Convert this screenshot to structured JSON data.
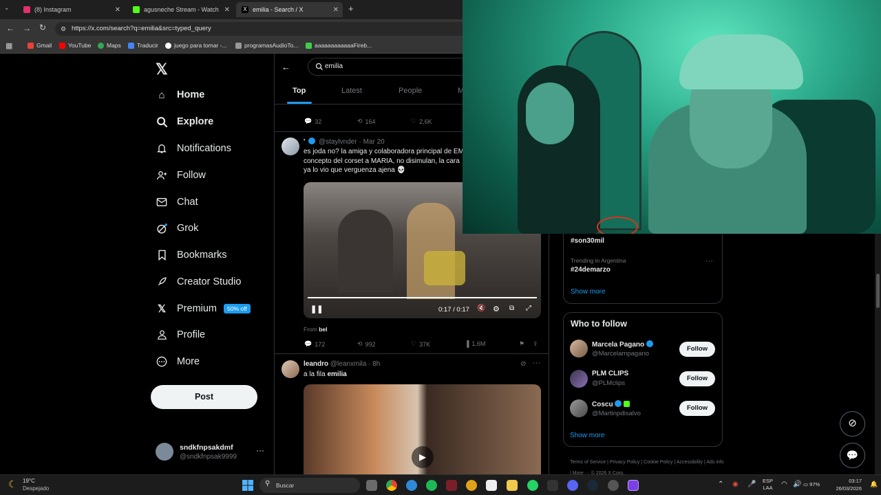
{
  "browser": {
    "tabs": [
      {
        "label": "(8) Instagram",
        "color": "#e1306c"
      },
      {
        "label": "agusneche Stream - Watch Live",
        "color": "#53fc18"
      },
      {
        "label": "emilia - Search / X",
        "color": "#ffffff"
      }
    ],
    "url": "https://x.com/search?q=emilia&src=typed_query",
    "bookmarks": [
      "Gmail",
      "YouTube",
      "Maps",
      "Traducir",
      "juego para tomar -...",
      "programasAudioTo...",
      "aaaaaaaaaaaaFireb..."
    ]
  },
  "sidebar": {
    "nav": [
      {
        "label": "Home",
        "icon": "home-icon"
      },
      {
        "label": "Explore",
        "icon": "search-icon"
      },
      {
        "label": "Notifications",
        "icon": "bell-icon"
      },
      {
        "label": "Follow",
        "icon": "person-plus-icon"
      },
      {
        "label": "Chat",
        "icon": "mail-icon"
      },
      {
        "label": "Grok",
        "icon": "grok-icon"
      },
      {
        "label": "Bookmarks",
        "icon": "bookmark-icon"
      },
      {
        "label": "Creator Studio",
        "icon": "rocket-icon"
      },
      {
        "label": "Premium",
        "icon": "x-logo-icon"
      },
      {
        "label": "Profile",
        "icon": "user-icon"
      },
      {
        "label": "More",
        "icon": "more-circle-icon"
      }
    ],
    "premium_badge": "50% off",
    "post_label": "Post",
    "account": {
      "name": "sndkfnpsakdmf",
      "handle": "@sndkfnpsak9999"
    }
  },
  "search": {
    "query": "emilia",
    "tabs": [
      "Top",
      "Latest",
      "People",
      "M"
    ]
  },
  "prev_tweet_actions": {
    "replies": "32",
    "reposts": "164",
    "likes": "2,6K"
  },
  "tweet1": {
    "name": "'",
    "handle": "@staylvnder",
    "time": "· Mar 20",
    "text_line1": "es joda no? la amiga y colaboradora principal de EM",
    "text_line2": "concepto del corset a MARIA, no disimulan, la cara",
    "text_line3": "ya lo vio que verguenza ajena 💀",
    "video_time": "0:17 / 0:17",
    "from_label": "From",
    "from_user": "bel",
    "replies": "172",
    "reposts": "992",
    "likes": "37K",
    "views": "1,6M"
  },
  "tweet2": {
    "name": "leandro",
    "handle": "@leanxmila",
    "time": "· 8h",
    "text_prefix": "a la fila",
    "text_bold": "emilia"
  },
  "trends": {
    "item1": "#son30mil",
    "item2_context": "Trending in Argentina",
    "item2": "#24demarzo",
    "show_more": "Show more"
  },
  "who_to_follow": {
    "title": "Who to follow",
    "users": [
      {
        "name": "Marcela Pagano",
        "handle": "@Marcelampagano",
        "button": "Follow"
      },
      {
        "name": "PLM CLIPS",
        "handle": "@PLMclips",
        "button": "Follow"
      },
      {
        "name": "Coscu",
        "handle": "@Martinpdisalvo",
        "button": "Follow"
      }
    ],
    "show_more": "Show more"
  },
  "footer": {
    "links": [
      "Terms of Service",
      "Privacy Policy",
      "Cookie Policy",
      "Accessibility",
      "Ads info",
      "More ···",
      "© 2026 X Corp."
    ]
  },
  "taskbar": {
    "weather_temp": "19°C",
    "weather_desc": "Despejado",
    "search_placeholder": "Buscar",
    "lang": "ESP",
    "lang2": "LAA",
    "battery": "97%",
    "time": "03:17",
    "date": "26/03/2026"
  }
}
